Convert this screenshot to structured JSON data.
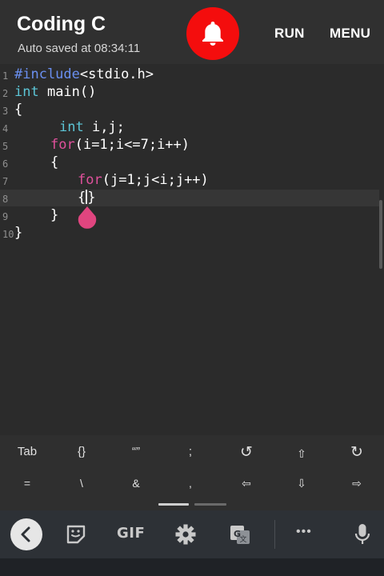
{
  "header": {
    "title": "Coding C",
    "subtitle": "Auto saved at 08:34:11",
    "run_label": "RUN",
    "menu_label": "MENU",
    "accent_color": "#f40d0d"
  },
  "editor": {
    "lines": [
      {
        "num": "1",
        "parts": [
          {
            "t": "#include",
            "c": "kw-blue"
          },
          {
            "t": "<stdio.h>",
            "c": ""
          }
        ]
      },
      {
        "num": "2",
        "parts": [
          {
            "t": "int",
            "c": "kw-cyan"
          },
          {
            "t": " main()",
            "c": ""
          }
        ]
      },
      {
        "num": "3",
        "parts": [
          {
            "t": "{",
            "c": ""
          }
        ]
      },
      {
        "num": "4",
        "parts": [
          {
            "t": "int",
            "c": "kw-cyan"
          },
          {
            "t": " i,j;",
            "c": ""
          }
        ]
      },
      {
        "num": "5",
        "parts": [
          {
            "t": "for",
            "c": "kw-pink"
          },
          {
            "t": "(i=1;i<=7;i++)",
            "c": ""
          }
        ]
      },
      {
        "num": "6",
        "parts": [
          {
            "t": "{",
            "c": ""
          }
        ]
      },
      {
        "num": "7",
        "parts": [
          {
            "t": "for",
            "c": "kw-pink"
          },
          {
            "t": "(j=1;j<i;j++)",
            "c": ""
          }
        ]
      },
      {
        "num": "8",
        "parts": [
          {
            "t": "{",
            "c": ""
          },
          {
            "t": "}",
            "c": ""
          }
        ]
      },
      {
        "num": "9",
        "parts": [
          {
            "t": "}",
            "c": ""
          }
        ]
      },
      {
        "num": "10",
        "parts": [
          {
            "t": "}",
            "c": ""
          }
        ]
      }
    ]
  },
  "keys": {
    "row1": [
      "Tab",
      "{}",
      "“”",
      ";",
      "↺",
      "⇧",
      "↻"
    ],
    "row2": [
      "=",
      "\\",
      "&",
      ",",
      "⇦",
      "⇩",
      "⇨"
    ]
  },
  "ime": {
    "gif_label": "GIF",
    "more_label": "•••"
  }
}
